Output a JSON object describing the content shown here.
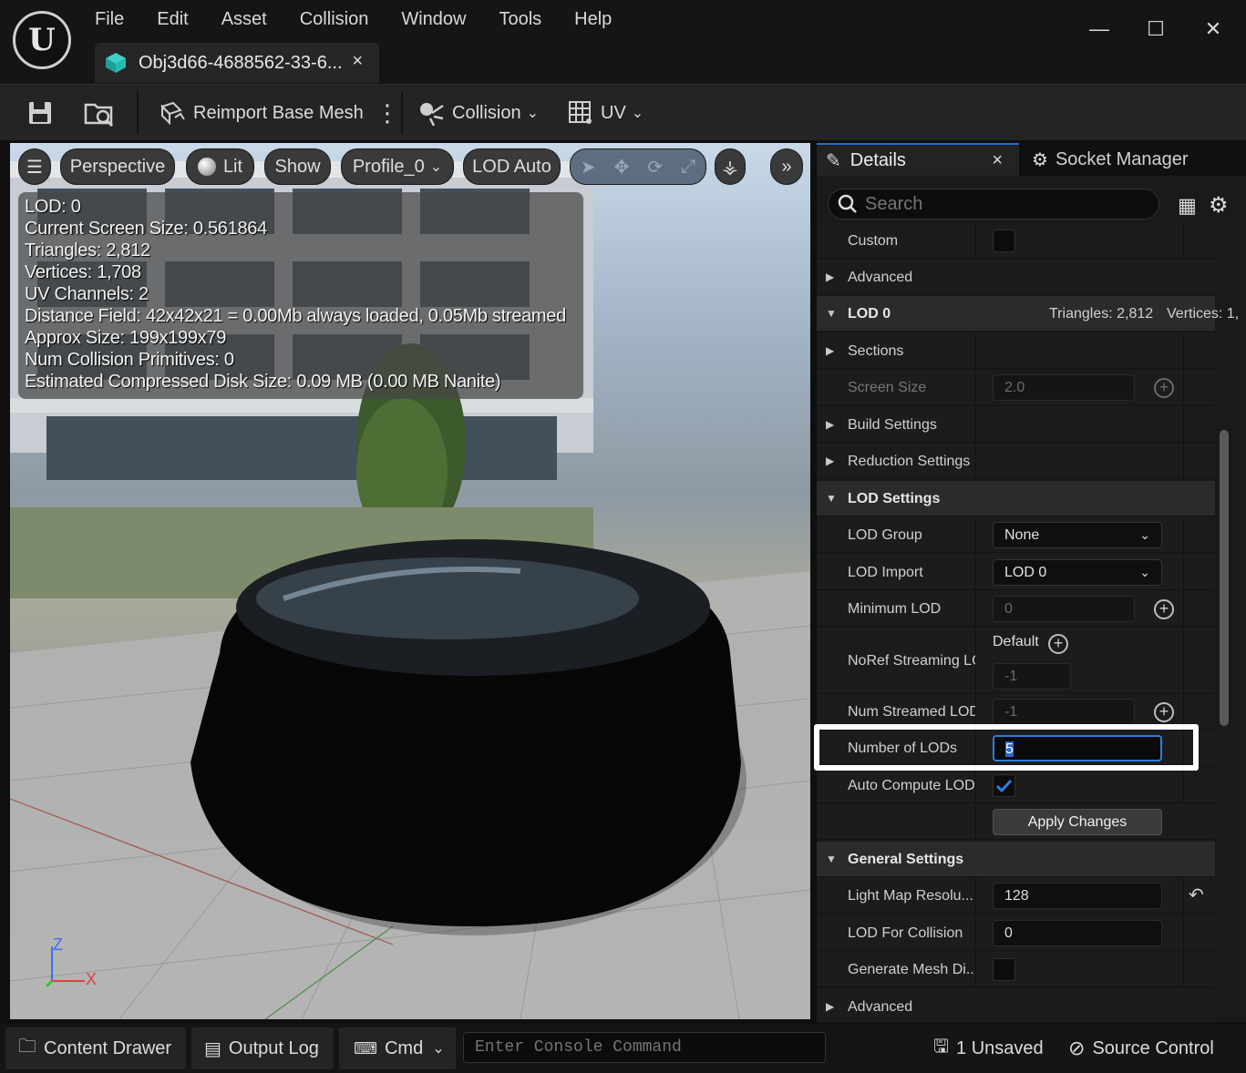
{
  "menu": [
    "File",
    "Edit",
    "Asset",
    "Collision",
    "Window",
    "Tools",
    "Help"
  ],
  "doc_tab": {
    "title": "Obj3d66-4688562-33-6...",
    "close": "×"
  },
  "window_controls": {
    "minimize": "—",
    "maximize": "☐",
    "close": "✕"
  },
  "toolbar": {
    "reimport": "Reimport Base Mesh",
    "collision": "Collision",
    "uv": "UV"
  },
  "viewport": {
    "perspective": "Perspective",
    "lit": "Lit",
    "show": "Show",
    "profile": "Profile_0",
    "lod": "LOD Auto",
    "stats": [
      "LOD:  0",
      "Current Screen Size:  0.561864",
      "Triangles:  2,812",
      "Vertices:  1,708",
      "UV Channels:  2",
      "Distance Field:  42x42x21 = 0.00Mb always loaded, 0.05Mb streamed",
      "Approx Size: 199x199x79",
      "Num Collision Primitives:  0",
      "Estimated Compressed Disk Size: 0.09 MB (0.00 MB Nanite)"
    ],
    "axis": {
      "z": "Z",
      "x": "X"
    }
  },
  "details": {
    "tab_details": "Details",
    "tab_close": "×",
    "tab_socket": "Socket Manager",
    "search_placeholder": "Search",
    "rows": {
      "custom": "Custom",
      "advanced1": "Advanced",
      "lod0": "LOD 0",
      "lod0_tris": "Triangles: 2,812",
      "lod0_verts": "Vertices: 1,",
      "sections": "Sections",
      "screen_size": "Screen Size",
      "screen_size_val": "2.0",
      "build_settings": "Build Settings",
      "reduction_settings": "Reduction Settings",
      "lod_settings": "LOD Settings",
      "lod_group": "LOD Group",
      "lod_group_val": "None",
      "lod_import": "LOD Import",
      "lod_import_val": "LOD 0",
      "min_lod": "Minimum LOD",
      "min_lod_val": "0",
      "noref": "NoRef Streaming LOD",
      "noref_default": "Default",
      "noref_val": "-1",
      "num_streamed": "Num Streamed LODs",
      "num_streamed_val": "-1",
      "num_lods": "Number of LODs",
      "num_lods_val": "5",
      "auto_compute": "Auto Compute LOD",
      "apply_changes": "Apply Changes",
      "general_settings": "General Settings",
      "light_map": "Light Map Resolu...",
      "light_map_val": "128",
      "lod_collision": "LOD For Collision",
      "lod_collision_val": "0",
      "gen_mesh": "Generate Mesh Di...",
      "advanced2": "Advanced"
    }
  },
  "statusbar": {
    "content_drawer": "Content Drawer",
    "output_log": "Output Log",
    "cmd": "Cmd",
    "console_placeholder": "Enter Console Command",
    "unsaved": "1 Unsaved",
    "source_control": "Source Control"
  },
  "colors": {
    "accent": "#1f6fd1",
    "checkbox_check": "#2f7de0"
  }
}
